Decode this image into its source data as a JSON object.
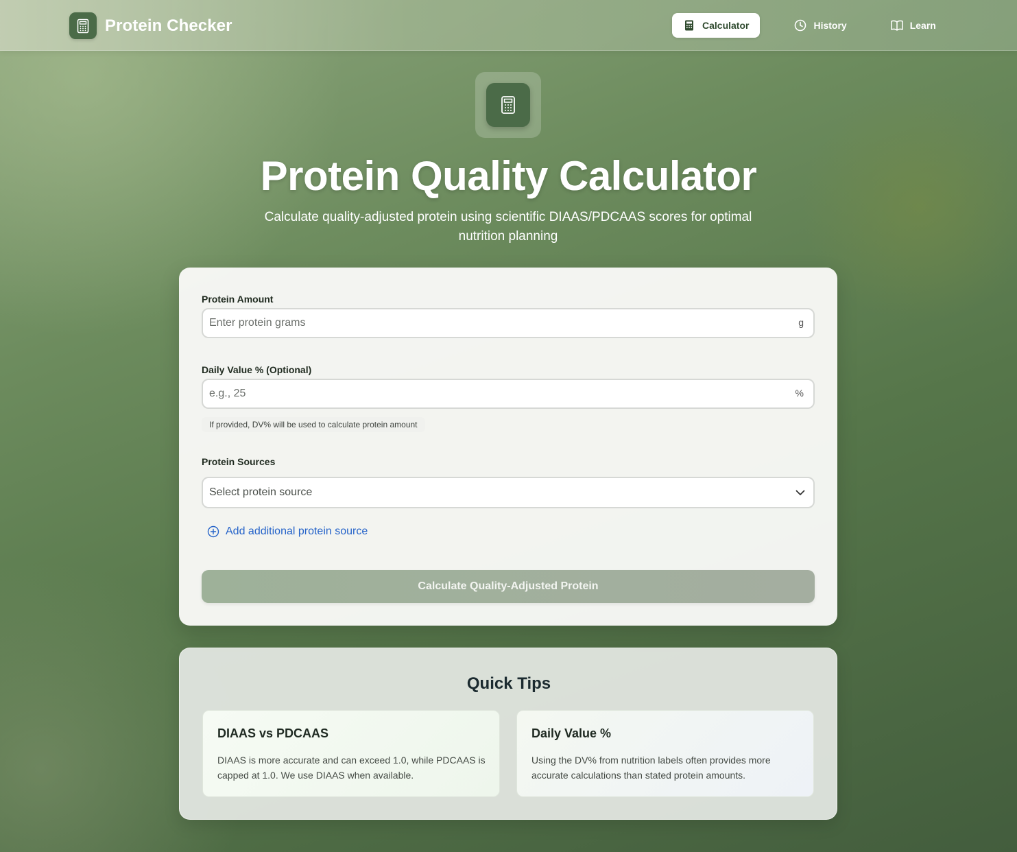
{
  "app": {
    "title": "Protein Checker"
  },
  "nav": {
    "items": [
      {
        "label": "Calculator",
        "icon": "calculator-icon",
        "active": true
      },
      {
        "label": "History",
        "icon": "clock-icon",
        "active": false
      },
      {
        "label": "Learn",
        "icon": "book-icon",
        "active": false
      }
    ]
  },
  "hero": {
    "icon": "calculator-icon",
    "title": "Protein Quality Calculator",
    "subtitle": "Calculate quality-adjusted protein using scientific DIAAS/PDCAAS scores for optimal nutrition planning"
  },
  "form": {
    "protein_amount": {
      "label": "Protein Amount",
      "placeholder": "Enter protein grams",
      "value": "",
      "suffix": "g"
    },
    "daily_value": {
      "label": "Daily Value % (Optional)",
      "placeholder": "e.g., 25",
      "value": "",
      "suffix": "%",
      "hint": "If provided, DV% will be used to calculate protein amount"
    },
    "protein_sources": {
      "label": "Protein Sources",
      "selected": "Select protein source"
    },
    "add_source_label": "Add additional protein source",
    "calculate_label": "Calculate Quality-Adjusted Protein"
  },
  "tips": {
    "title": "Quick Tips",
    "items": [
      {
        "title": "DIAAS vs PDCAAS",
        "body": "DIAAS is more accurate and can exceed 1.0, while PDCAAS is capped at 1.0. We use DIAAS when available."
      },
      {
        "title": "Daily Value %",
        "body": "Using the DV% from nutrition labels often provides more accurate calculations than stated protein amounts."
      }
    ]
  },
  "colors": {
    "brand_green": "#4b6b48",
    "link_blue": "#2563c9",
    "button_disabled": "#a4aea0"
  }
}
